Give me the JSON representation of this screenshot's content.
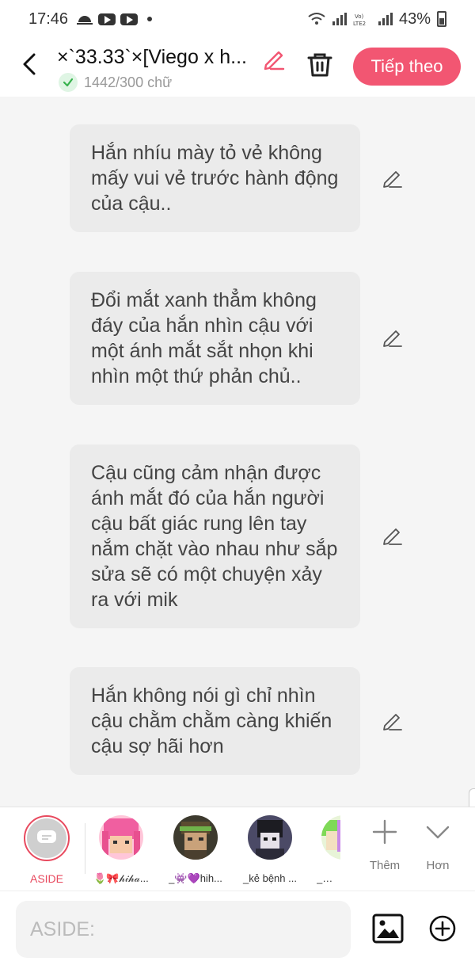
{
  "status_bar": {
    "time": "17:46",
    "battery": "43%",
    "icons": [
      "weather-icon",
      "youtube-icon",
      "youtube-icon",
      "notification-dot",
      "wifi-icon",
      "signal-icon",
      "volte-icon",
      "signal-icon",
      "battery-icon"
    ]
  },
  "header": {
    "title": "×`33.33`×[Viego x h...",
    "word_count": "1442/300 chữ",
    "next_label": "Tiếp theo",
    "icons": [
      "back-arrow-icon",
      "pencil-icon",
      "check-icon",
      "trash-icon"
    ]
  },
  "messages": [
    {
      "text": "Hắn nhíu mày tỏ vẻ không mấy vui vẻ trước hành động của cậu.."
    },
    {
      "text": "Đổi mắt xanh thẳm không đáy của hắn nhìn cậu với một ánh mắt sắt nhọn khi nhìn một thứ phản chủ.."
    },
    {
      "text": "Cậu cũng cảm nhận được ánh mắt đó của hắn người cậu bất giác rung lên tay nắm chặt vào nhau như sắp sửa sẽ có một chuyện xảy ra với mik"
    },
    {
      "text": "Hắn không nói gì chỉ nhìn cậu chằm chằm càng khiến cậu sợ hãi hơn"
    }
  ],
  "characters": {
    "aside_label": "ASIDE",
    "items": [
      {
        "name": "🌷🎀𝒽𝒾𝒽𝒶..."
      },
      {
        "name": "_👾💜hih..."
      },
      {
        "name": "_kẻ bệnh ..."
      },
      {
        "name": "_🎋🕸..."
      }
    ],
    "add_label": "Thêm",
    "more_label": "Hơn"
  },
  "composer": {
    "placeholder": "ASIDE:"
  },
  "colors": {
    "accent": "#f25672",
    "aside_ring": "#e84a5f",
    "bubble": "#ebebeb",
    "background": "#f5f5f5"
  }
}
